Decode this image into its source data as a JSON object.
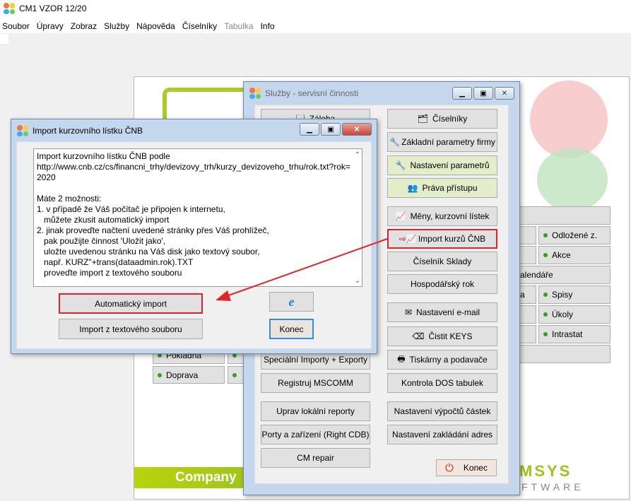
{
  "app": {
    "title": "CM1 VZOR 12/20",
    "menu": [
      "Soubor",
      "Úpravy",
      "Zobraz",
      "Služby",
      "Nápověda",
      "Číselníky",
      "Tabulka",
      "Info"
    ],
    "disabled_menu": "Tabulka"
  },
  "background": {
    "company_label": "Company",
    "logo_text": "MSYS",
    "logo_sub": "FTWARE",
    "right_items": [
      "",
      "Odložené z.",
      "Akce",
      "alendáře",
      "Spisy",
      "Úkoly",
      "Intrastat",
      ""
    ],
    "left_items": [
      "Pokladna",
      "Doprava"
    ],
    "partial_a": "a"
  },
  "sluzby": {
    "title": "Služby - servisní činnosti",
    "left_buttons": [
      "Záloha",
      "Speciální Importy + Exporty",
      "Registruj MSCOMM",
      "Uprav lokální reporty",
      "Porty a zařízení (Right CDB)",
      "CM repair"
    ],
    "right_buttons": [
      "Číselníky",
      "Základní parametry firmy",
      "Nastavení parametrů",
      "Práva přístupu",
      "Měny, kurzovní lístek",
      "Import kurzů ČNB",
      "Číselník Sklady",
      "Hospodářský rok",
      "Nastavení e-mail",
      "Čistit KEYS",
      "Tiskárny a podavače",
      "Kontrola DOS tabulek",
      "Nastavení výpočtů částek",
      "Nastavení zakládání adres"
    ],
    "konec": "Konec"
  },
  "import_dialog": {
    "title": "Import kurzovního lístku ČNB",
    "text": "Import kurzovního lístku ČNB podle\nhttp://www.cnb.cz/cs/financni_trhy/devizovy_trh/kurzy_devizoveho_trhu/rok.txt?rok=\n2020\n\nMáte 2 možnosti:\n1. v případě že Váš počítač je připojen k internetu,\n   můžete zkusit automatický import\n2. jinak proveďte načtení uvedené stránky přes Váš prohlížeč,\n   pak použijte činnost 'Uložit jako',\n   uložte uvedenou stránku na Váš disk jako textový soubor,\n   např. KURZ\"+trans(dataadmin.rok).TXT\n   proveďte import z textového souboru",
    "auto_button": "Automatický import",
    "file_button": "Import z textového souboru",
    "ie_icon": "internet-explorer-icon",
    "konec": "Konec"
  },
  "colors": {
    "highlight": "#e0242b",
    "green": "#9fc31a",
    "button_bg": "#e1e1e1"
  }
}
